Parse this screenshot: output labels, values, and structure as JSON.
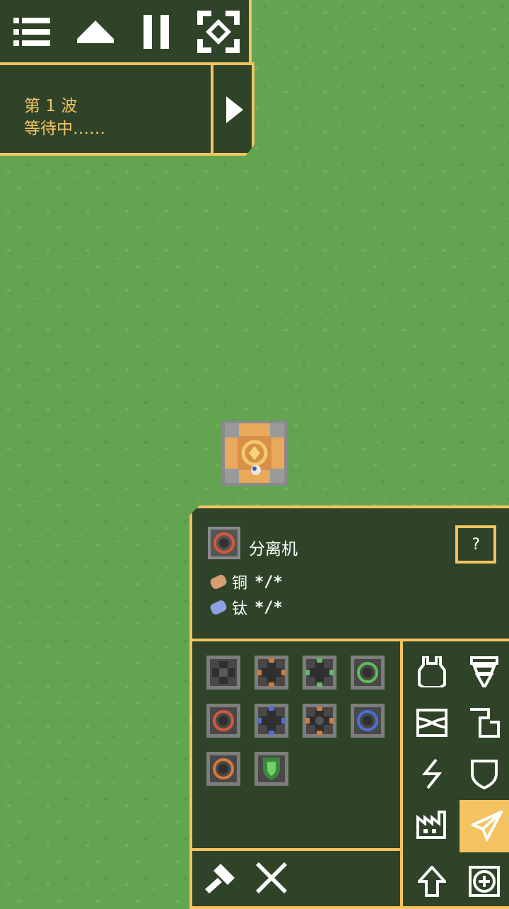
{
  "hud": {
    "menu_icon": "menu-icon",
    "minimap_icon": "chevron-up-icon",
    "pause_icon": "pause-icon",
    "database_icon": "target-icon",
    "wave_title": "第 1 波",
    "wave_status": "等待中……",
    "skip_wave_icon": "play-icon"
  },
  "selected_block": {
    "name": "分离机",
    "help_label": "?",
    "requirements": [
      {
        "item": "铜",
        "amount": "*/*",
        "color": "#d99d73"
      },
      {
        "item": "钛",
        "amount": "*/*",
        "color": "#8da1e3"
      }
    ]
  },
  "block_list": [
    {
      "name": "separator-gray",
      "accent": "#5a5a5a"
    },
    {
      "name": "block-orange",
      "accent": "#d87a3a"
    },
    {
      "name": "block-green",
      "accent": "#5bbf5a"
    },
    {
      "name": "block-green-ring",
      "accent": "#5bbf5a"
    },
    {
      "name": "block-red-ring",
      "accent": "#d8563a"
    },
    {
      "name": "block-blue",
      "accent": "#4a6fd8"
    },
    {
      "name": "block-orange-ring",
      "accent": "#d87a3a"
    },
    {
      "name": "block-blue-ring",
      "accent": "#4a6fd8"
    },
    {
      "name": "block-orange-ring-2",
      "accent": "#d87a3a"
    },
    {
      "name": "block-green-shield",
      "accent": "#5bbf5a"
    }
  ],
  "tools": [
    "hammer-icon",
    "cancel-icon"
  ],
  "categories": [
    "turret-icon",
    "drill-icon",
    "distribution-icon",
    "liquid-icon",
    "power-icon",
    "defense-icon",
    "crafting-icon",
    "units-icon",
    "upgrade-icon",
    "effect-icon"
  ],
  "active_category": "units-icon",
  "colors": {
    "accent": "#f4c361",
    "panel": "#2e4327",
    "grass": "#62a450"
  }
}
